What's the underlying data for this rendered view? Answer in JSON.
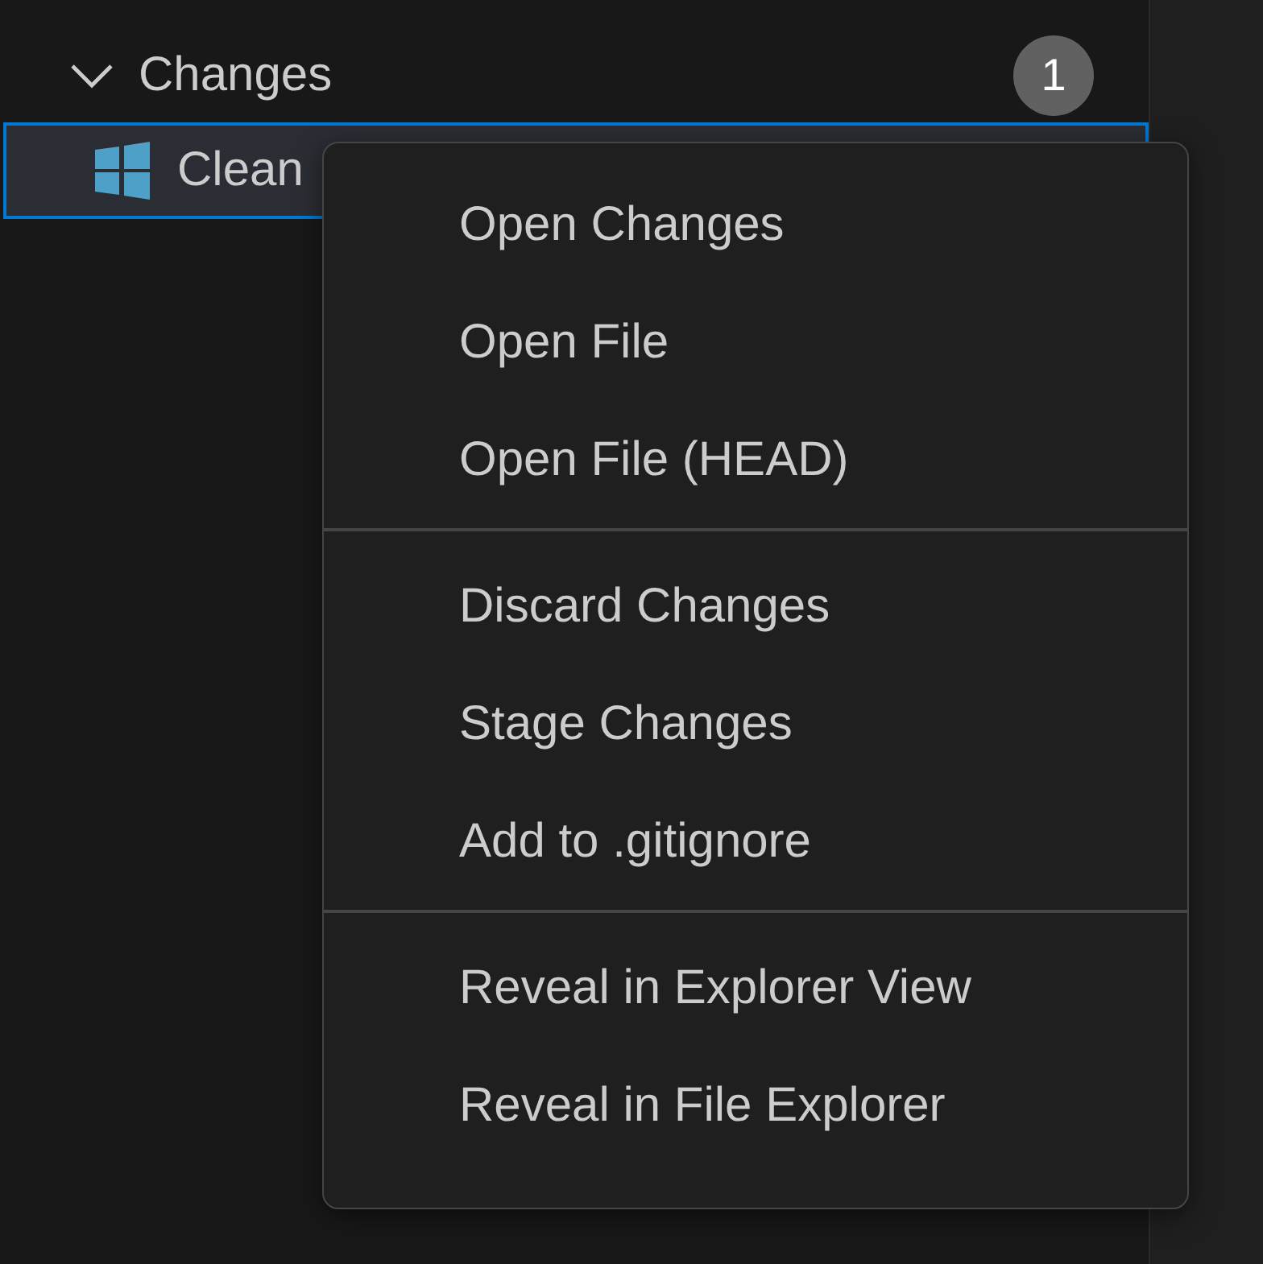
{
  "section": {
    "title": "Changes",
    "expanded": true,
    "count": "1"
  },
  "files": [
    {
      "name": "Clean",
      "selected": true
    }
  ],
  "context_menu": {
    "groups": [
      [
        "Open Changes",
        "Open File",
        "Open File (HEAD)"
      ],
      [
        "Discard Changes",
        "Stage Changes",
        "Add to .gitignore"
      ],
      [
        "Reveal in Explorer View",
        "Reveal in File Explorer"
      ]
    ]
  }
}
